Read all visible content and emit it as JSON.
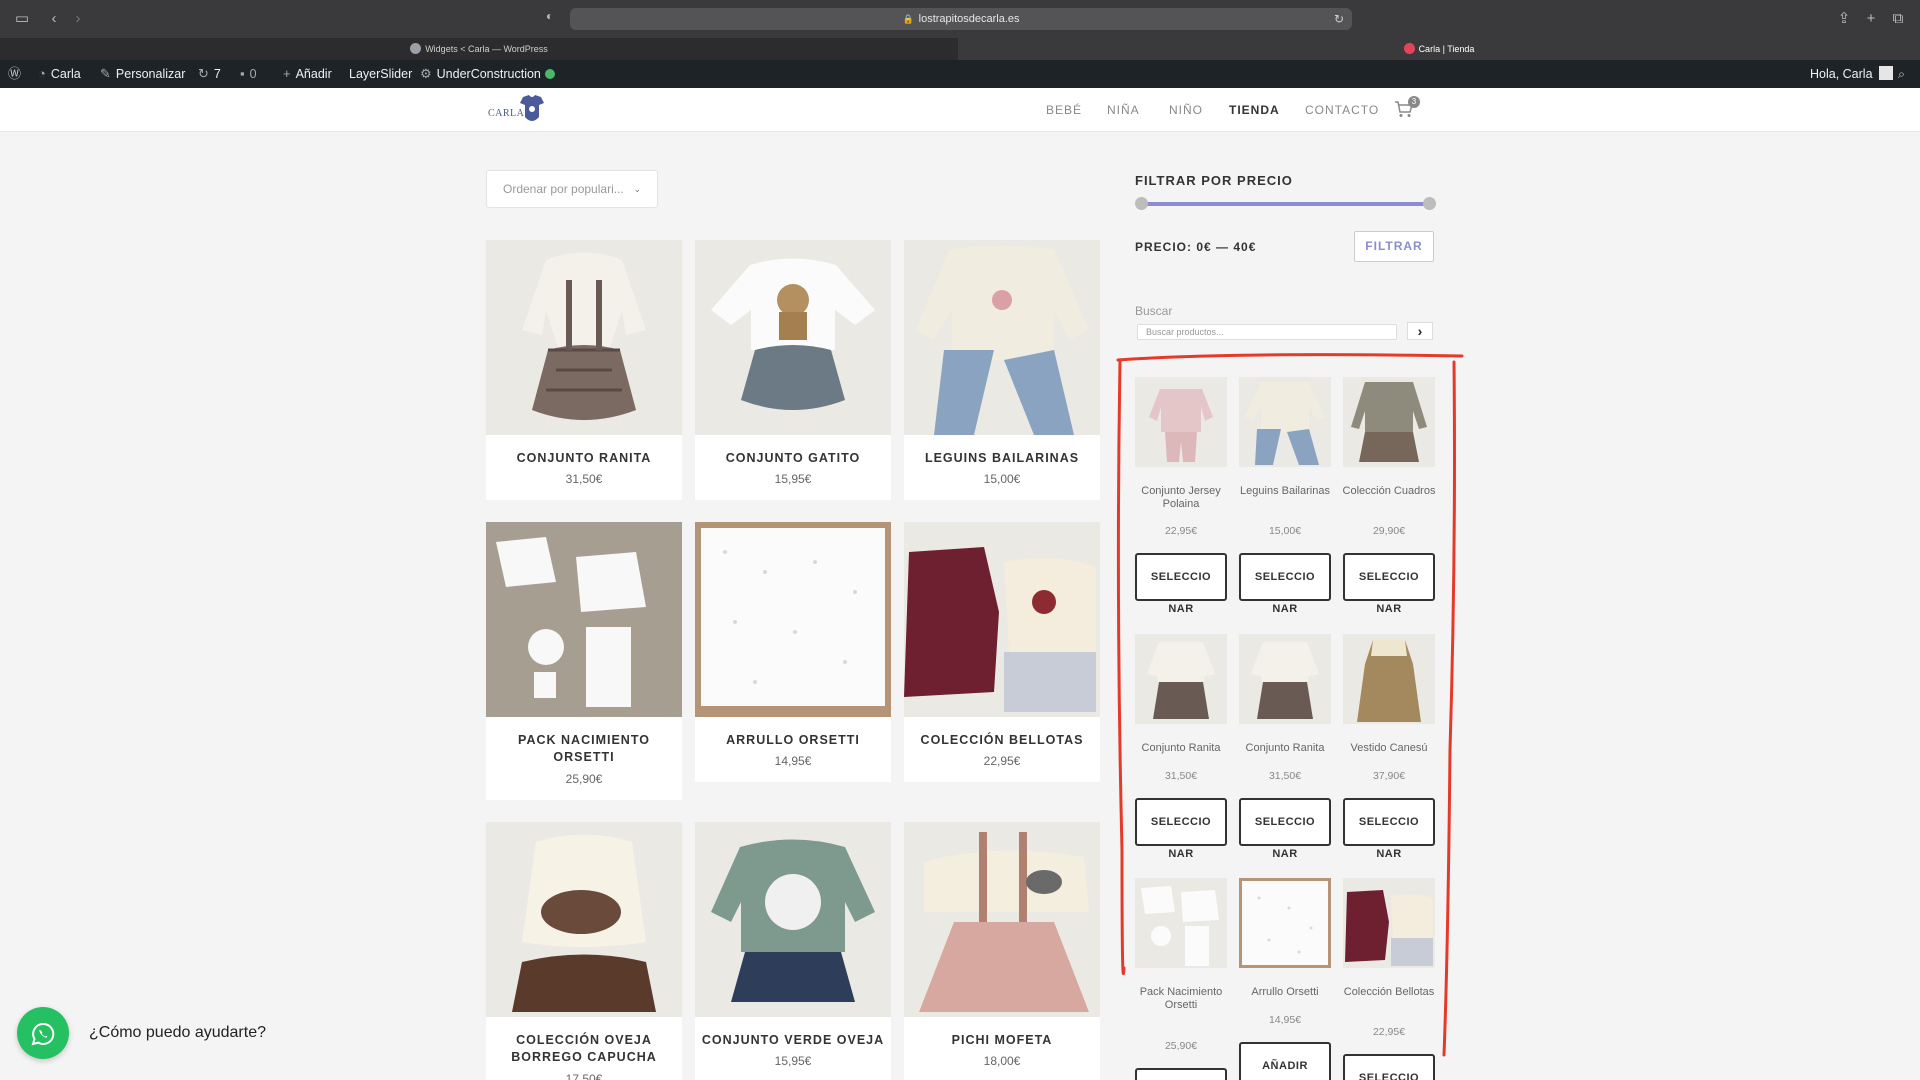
{
  "browser": {
    "url": "lostrapitosdecarla.es",
    "tabs": [
      {
        "label": "Widgets < Carla — WordPress"
      },
      {
        "label": "Carla | Tienda"
      }
    ]
  },
  "admin_bar": {
    "site": "Carla",
    "customize": "Personalizar",
    "updates": "7",
    "comments": "0",
    "add": "Añadir",
    "layerslider": "LayerSlider",
    "underconstruction": "UnderConstruction",
    "greeting": "Hola, Carla"
  },
  "header": {
    "logo_text": "CARLA",
    "nav": [
      "BEBÉ",
      "NIÑA",
      "NIÑO",
      "TIENDA",
      "CONTACTO"
    ],
    "active_nav": "TIENDA",
    "cart_count": "3"
  },
  "shop": {
    "sort_label": "Ordenar por populari...",
    "products": [
      {
        "name": "CONJUNTO RANITA",
        "price": "31,50€"
      },
      {
        "name": "CONJUNTO GATITO",
        "price": "15,95€"
      },
      {
        "name": "LEGUINS BAILARINAS",
        "price": "15,00€"
      },
      {
        "name": "PACK NACIMIENTO ORSETTI",
        "price": "25,90€"
      },
      {
        "name": "ARRULLO ORSETTI",
        "price": "14,95€"
      },
      {
        "name": "COLECCIÓN BELLOTAS",
        "price": "22,95€"
      },
      {
        "name": "COLECCIÓN OVEJA BORREGO CAPUCHA",
        "price": "17,50€"
      },
      {
        "name": "CONJUNTO VERDE OVEJA",
        "price": "15,95€"
      },
      {
        "name": "PICHI MOFETA",
        "price": "18,00€"
      }
    ]
  },
  "sidebar": {
    "filter_title": "FILTRAR POR PRECIO",
    "price_range": "PRECIO: 0€ — 40€",
    "filter_button": "FILTRAR",
    "search_label": "Buscar",
    "search_placeholder": "Buscar productos...",
    "mini_products": [
      {
        "name": "Conjunto Jersey Polaina",
        "price": "22,95€",
        "btn": "SELECCIO",
        "btn2": "NAR"
      },
      {
        "name": "Leguins Bailarinas",
        "price": "15,00€",
        "btn": "SELECCIO",
        "btn2": "NAR"
      },
      {
        "name": "Colección Cuadros",
        "price": "29,90€",
        "btn": "SELECCIO",
        "btn2": "NAR"
      },
      {
        "name": "Conjunto Ranita",
        "price": "31,50€",
        "btn": "SELECCIO",
        "btn2": "NAR"
      },
      {
        "name": "Conjunto Ranita",
        "price": "31,50€",
        "btn": "SELECCIO",
        "btn2": "NAR"
      },
      {
        "name": "Vestido Canesú",
        "price": "37,90€",
        "btn": "SELECCIO",
        "btn2": "NAR"
      },
      {
        "name": "Pack Nacimiento Orsetti",
        "price": "25,90€",
        "btn": "",
        "btn2": ""
      },
      {
        "name": "Arrullo Orsetti",
        "price": "14,95€",
        "btn": "AÑADIR",
        "btn2": ""
      },
      {
        "name": "Colección Bellotas",
        "price": "22,95€",
        "btn": "SELECCIO",
        "btn2": ""
      }
    ]
  },
  "chat": {
    "text": "¿Cómo puedo ayudarte?"
  },
  "colors": {
    "accent": "#8c8cd0",
    "admin_bar": "#1d2327",
    "whatsapp": "#25c062",
    "annotation": "#e53a2a"
  }
}
